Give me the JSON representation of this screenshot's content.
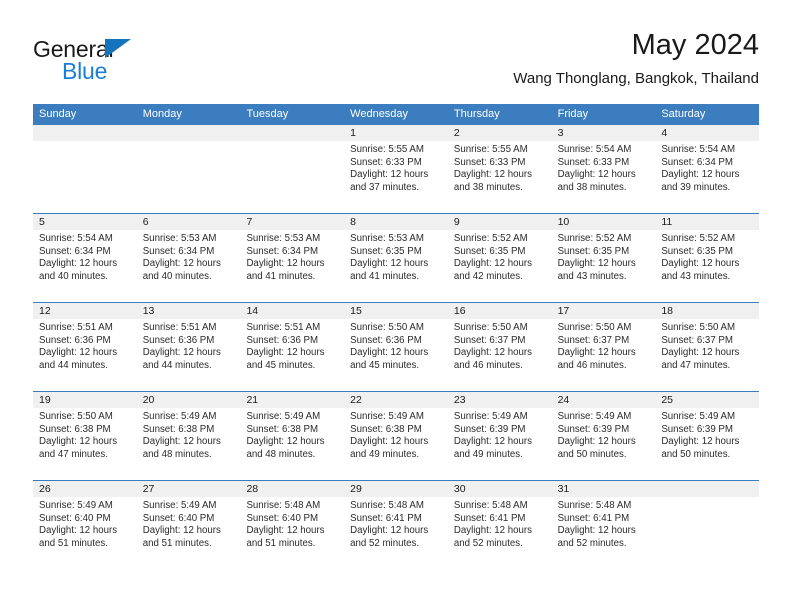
{
  "brand": {
    "name_top": "General",
    "name_bottom": "Blue"
  },
  "header": {
    "title": "May 2024",
    "subtitle": "Wang Thonglang, Bangkok, Thailand"
  },
  "colors": {
    "header_blue": "#3b7dbf",
    "day_band_gray": "#f0f0f0",
    "brand_blue": "#1a7fd4"
  },
  "weekdays": [
    "Sunday",
    "Monday",
    "Tuesday",
    "Wednesday",
    "Thursday",
    "Friday",
    "Saturday"
  ],
  "weeks": [
    [
      {
        "day": "",
        "lines": []
      },
      {
        "day": "",
        "lines": []
      },
      {
        "day": "",
        "lines": []
      },
      {
        "day": "1",
        "lines": [
          "Sunrise: 5:55 AM",
          "Sunset: 6:33 PM",
          "Daylight: 12 hours",
          "and 37 minutes."
        ]
      },
      {
        "day": "2",
        "lines": [
          "Sunrise: 5:55 AM",
          "Sunset: 6:33 PM",
          "Daylight: 12 hours",
          "and 38 minutes."
        ]
      },
      {
        "day": "3",
        "lines": [
          "Sunrise: 5:54 AM",
          "Sunset: 6:33 PM",
          "Daylight: 12 hours",
          "and 38 minutes."
        ]
      },
      {
        "day": "4",
        "lines": [
          "Sunrise: 5:54 AM",
          "Sunset: 6:34 PM",
          "Daylight: 12 hours",
          "and 39 minutes."
        ]
      }
    ],
    [
      {
        "day": "5",
        "lines": [
          "Sunrise: 5:54 AM",
          "Sunset: 6:34 PM",
          "Daylight: 12 hours",
          "and 40 minutes."
        ]
      },
      {
        "day": "6",
        "lines": [
          "Sunrise: 5:53 AM",
          "Sunset: 6:34 PM",
          "Daylight: 12 hours",
          "and 40 minutes."
        ]
      },
      {
        "day": "7",
        "lines": [
          "Sunrise: 5:53 AM",
          "Sunset: 6:34 PM",
          "Daylight: 12 hours",
          "and 41 minutes."
        ]
      },
      {
        "day": "8",
        "lines": [
          "Sunrise: 5:53 AM",
          "Sunset: 6:35 PM",
          "Daylight: 12 hours",
          "and 41 minutes."
        ]
      },
      {
        "day": "9",
        "lines": [
          "Sunrise: 5:52 AM",
          "Sunset: 6:35 PM",
          "Daylight: 12 hours",
          "and 42 minutes."
        ]
      },
      {
        "day": "10",
        "lines": [
          "Sunrise: 5:52 AM",
          "Sunset: 6:35 PM",
          "Daylight: 12 hours",
          "and 43 minutes."
        ]
      },
      {
        "day": "11",
        "lines": [
          "Sunrise: 5:52 AM",
          "Sunset: 6:35 PM",
          "Daylight: 12 hours",
          "and 43 minutes."
        ]
      }
    ],
    [
      {
        "day": "12",
        "lines": [
          "Sunrise: 5:51 AM",
          "Sunset: 6:36 PM",
          "Daylight: 12 hours",
          "and 44 minutes."
        ]
      },
      {
        "day": "13",
        "lines": [
          "Sunrise: 5:51 AM",
          "Sunset: 6:36 PM",
          "Daylight: 12 hours",
          "and 44 minutes."
        ]
      },
      {
        "day": "14",
        "lines": [
          "Sunrise: 5:51 AM",
          "Sunset: 6:36 PM",
          "Daylight: 12 hours",
          "and 45 minutes."
        ]
      },
      {
        "day": "15",
        "lines": [
          "Sunrise: 5:50 AM",
          "Sunset: 6:36 PM",
          "Daylight: 12 hours",
          "and 45 minutes."
        ]
      },
      {
        "day": "16",
        "lines": [
          "Sunrise: 5:50 AM",
          "Sunset: 6:37 PM",
          "Daylight: 12 hours",
          "and 46 minutes."
        ]
      },
      {
        "day": "17",
        "lines": [
          "Sunrise: 5:50 AM",
          "Sunset: 6:37 PM",
          "Daylight: 12 hours",
          "and 46 minutes."
        ]
      },
      {
        "day": "18",
        "lines": [
          "Sunrise: 5:50 AM",
          "Sunset: 6:37 PM",
          "Daylight: 12 hours",
          "and 47 minutes."
        ]
      }
    ],
    [
      {
        "day": "19",
        "lines": [
          "Sunrise: 5:50 AM",
          "Sunset: 6:38 PM",
          "Daylight: 12 hours",
          "and 47 minutes."
        ]
      },
      {
        "day": "20",
        "lines": [
          "Sunrise: 5:49 AM",
          "Sunset: 6:38 PM",
          "Daylight: 12 hours",
          "and 48 minutes."
        ]
      },
      {
        "day": "21",
        "lines": [
          "Sunrise: 5:49 AM",
          "Sunset: 6:38 PM",
          "Daylight: 12 hours",
          "and 48 minutes."
        ]
      },
      {
        "day": "22",
        "lines": [
          "Sunrise: 5:49 AM",
          "Sunset: 6:38 PM",
          "Daylight: 12 hours",
          "and 49 minutes."
        ]
      },
      {
        "day": "23",
        "lines": [
          "Sunrise: 5:49 AM",
          "Sunset: 6:39 PM",
          "Daylight: 12 hours",
          "and 49 minutes."
        ]
      },
      {
        "day": "24",
        "lines": [
          "Sunrise: 5:49 AM",
          "Sunset: 6:39 PM",
          "Daylight: 12 hours",
          "and 50 minutes."
        ]
      },
      {
        "day": "25",
        "lines": [
          "Sunrise: 5:49 AM",
          "Sunset: 6:39 PM",
          "Daylight: 12 hours",
          "and 50 minutes."
        ]
      }
    ],
    [
      {
        "day": "26",
        "lines": [
          "Sunrise: 5:49 AM",
          "Sunset: 6:40 PM",
          "Daylight: 12 hours",
          "and 51 minutes."
        ]
      },
      {
        "day": "27",
        "lines": [
          "Sunrise: 5:49 AM",
          "Sunset: 6:40 PM",
          "Daylight: 12 hours",
          "and 51 minutes."
        ]
      },
      {
        "day": "28",
        "lines": [
          "Sunrise: 5:48 AM",
          "Sunset: 6:40 PM",
          "Daylight: 12 hours",
          "and 51 minutes."
        ]
      },
      {
        "day": "29",
        "lines": [
          "Sunrise: 5:48 AM",
          "Sunset: 6:41 PM",
          "Daylight: 12 hours",
          "and 52 minutes."
        ]
      },
      {
        "day": "30",
        "lines": [
          "Sunrise: 5:48 AM",
          "Sunset: 6:41 PM",
          "Daylight: 12 hours",
          "and 52 minutes."
        ]
      },
      {
        "day": "31",
        "lines": [
          "Sunrise: 5:48 AM",
          "Sunset: 6:41 PM",
          "Daylight: 12 hours",
          "and 52 minutes."
        ]
      },
      {
        "day": "",
        "lines": []
      }
    ]
  ]
}
